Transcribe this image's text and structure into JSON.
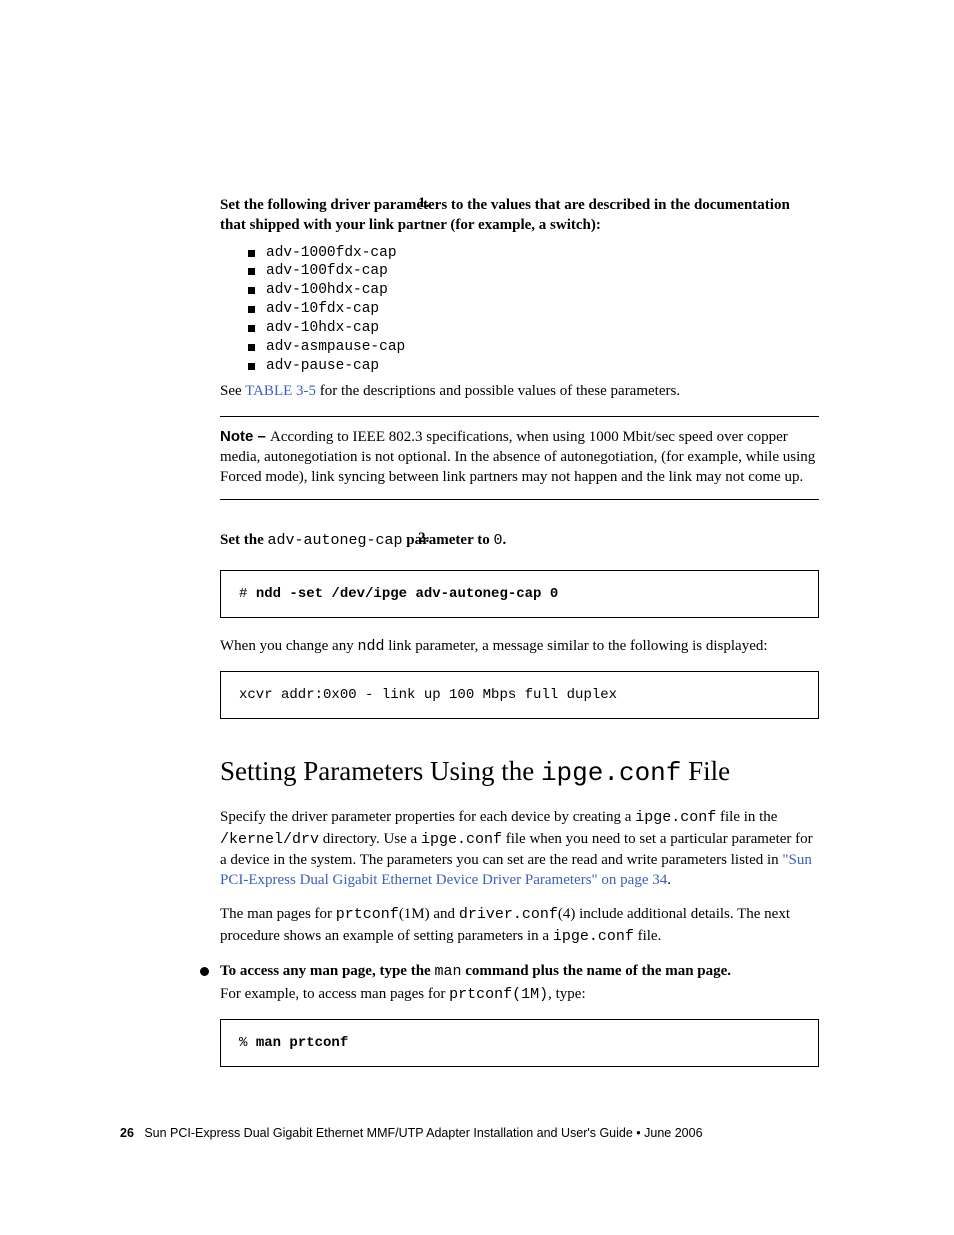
{
  "step1": {
    "num": "1.",
    "text": "Set the following driver parameters to the values that are described in the documentation that shipped with your link partner (for example, a switch):",
    "bullets": [
      "adv-1000fdx-cap",
      "adv-100fdx-cap",
      "adv-100hdx-cap",
      "adv-10fdx-cap",
      "adv-10hdx-cap",
      "adv-asmpause-cap",
      "adv-pause-cap"
    ],
    "see_pre": "See ",
    "see_link": "TABLE 3-5",
    "see_post": " for the descriptions and possible values of these parameters."
  },
  "note": {
    "label": "Note – ",
    "text": "According to IEEE 802.3 specifications, when using 1000 Mbit/sec speed over copper media, autonegotiation is not optional. In the absence of autonegotiation, (for example, while using Forced mode), link syncing between link partners may not happen and the link may not come up."
  },
  "step2": {
    "num": "2.",
    "pre": "Set the ",
    "mono1": "adv-autoneg-cap",
    "mid": " parameter to ",
    "mono2": "0",
    "post": "."
  },
  "code1": {
    "prompt": "# ",
    "cmd": "ndd -set /dev/ipge adv-autoneg-cap 0"
  },
  "after_code1": {
    "pre": "When you change any ",
    "mono": "ndd",
    "post": " link parameter, a message similar to the following is displayed:"
  },
  "code2": "xcvr addr:0x00 - link up 100 Mbps full duplex",
  "heading": {
    "pre": "Setting Parameters Using the ",
    "mono": "ipge.conf",
    "post": " File"
  },
  "para1": {
    "t1": "Specify the driver parameter properties for each device by creating a ",
    "m1": "ipge.conf",
    "t2": " file in the ",
    "m2": "/kernel/drv",
    "t3": " directory. Use a ",
    "m3": "ipge.conf",
    "t4": " file when you need to set a particular parameter for a device in the system. The parameters you can set are the read and write parameters listed in ",
    "link": "\"Sun PCI-Express Dual Gigabit Ethernet Device Driver Parameters\" on page 34",
    "t5": "."
  },
  "para2": {
    "t1": "The man pages for ",
    "m1": "prtconf",
    "t2": "(1M) and ",
    "m2": "driver.conf",
    "t3": "(4) include additional details. The next procedure shows an example of setting parameters in a ",
    "m3": "ipge.conf",
    "t4": " file."
  },
  "bullet_step": {
    "title_pre": "To access any man page, type the ",
    "title_mono": "man",
    "title_post": " command plus the name of the man page.",
    "sub_pre": "For example, to access man pages for ",
    "sub_mono": "prtconf(1M)",
    "sub_post": ", type:"
  },
  "code3": {
    "prompt": "% ",
    "cmd": "man prtconf"
  },
  "footer": {
    "page": "26",
    "title": "Sun PCI-Express Dual Gigabit Ethernet MMF/UTP Adapter Installation and User's Guide  •  June 2006"
  }
}
